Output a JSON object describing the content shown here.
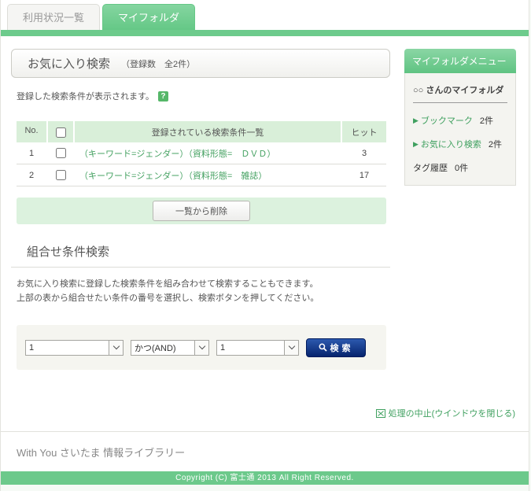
{
  "tabs": [
    {
      "label": "利用状況一覧",
      "active": false
    },
    {
      "label": "マイフォルダ",
      "active": true
    }
  ],
  "favorites": {
    "title": "お気に入り検索",
    "subtitle": "（登録数　全2件）",
    "note": "登録した検索条件が表示されます。",
    "help_icon": "?",
    "table": {
      "header_no": "No.",
      "header_list": "登録されている検索条件一覧",
      "header_hits": "ヒット",
      "rows": [
        {
          "no": "1",
          "condition": "（キーワード=ジェンダー）（資料形態=　ＤＶＤ）",
          "hits": "3"
        },
        {
          "no": "2",
          "condition": "（キーワード=ジェンダー）（資料形態=　雑誌）",
          "hits": "17"
        }
      ]
    },
    "delete_button": "一覧から削除"
  },
  "combine": {
    "title": "組合せ条件検索",
    "description_line1": "お気に入り検索に登録した検索条件を組み合わせて検索することもできます。",
    "description_line2": "上部の表から組合せたい条件の番号を選択し、検索ボタンを押してください。",
    "select1_value": "1",
    "operator_value": "かつ(AND)",
    "select2_value": "1",
    "search_button": "検索"
  },
  "cancel_link": "処理の中止(ウインドウを閉じる)",
  "sidebar": {
    "title": "マイフォルダメニュー",
    "owner": "○○ さんのマイフォルダ",
    "items": [
      {
        "label": "ブックマーク",
        "count": "2件"
      },
      {
        "label": "お気に入り検索",
        "count": "2件"
      },
      {
        "label": "タグ履歴",
        "count": "0件"
      }
    ]
  },
  "footer": {
    "site": "With You さいたま 情報ライブラリー",
    "copyright": "Copyright (C) 富士通 2013 All Right Reserved."
  },
  "colors": {
    "accent_green": "#6dcb8c",
    "light_green_header": "#d9efd9",
    "light_green_band": "#dcf2de",
    "link_green": "#3fa05f",
    "search_button_navy": "#06246e"
  }
}
